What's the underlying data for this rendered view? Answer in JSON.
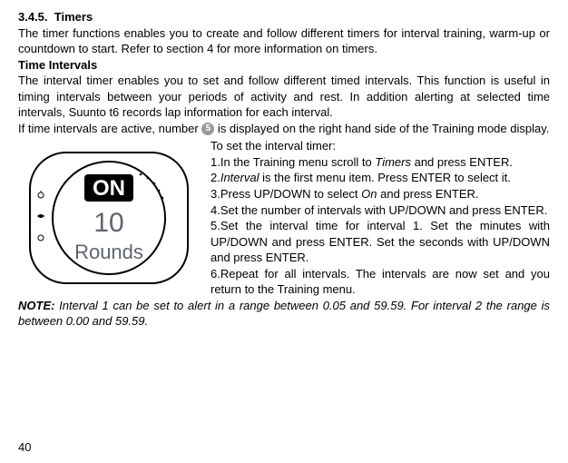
{
  "heading_number": "3.4.5.",
  "heading_title": "Timers",
  "intro": "The timer functions enables you to create and follow different timers for interval training, warm-up or countdown to start. Refer to section 4 for more information on timers.",
  "sub_heading": "Time Intervals",
  "sub_para1": "The interval timer enables you to set and follow different timed intervals. This function is useful in timing intervals between your periods of activity and rest. In addition alerting at selected time intervals, Suunto t6 records lap information for each interval.",
  "sub_para2_a": "If time intervals are active, number ",
  "circle_number": "5",
  "sub_para2_b": " is displayed on the right hand side of the Training mode display.",
  "watch": {
    "top": "ON",
    "mid": "10",
    "bottom": "Rounds"
  },
  "instr_lead": "To set the interval timer:",
  "instr1_a": "1.In the Training menu scroll to ",
  "instr1_i": "Timers",
  "instr1_b": " and press ENTER.",
  "instr2_a": "2.",
  "instr2_i": "Interval",
  "instr2_b": " is the first menu item. Press ENTER to select it.",
  "instr3_a": "3.Press UP/DOWN to select ",
  "instr3_i": "On",
  "instr3_b": " and press ENTER.",
  "instr4": "4.Set the number of intervals with UP/DOWN and press ENTER.",
  "instr5": "5.Set the interval time for interval 1. Set the minutes with UP/DOWN and press ENTER. Set the seconds with UP/DOWN and press ENTER.",
  "instr6": "6.Repeat for all intervals. The intervals are now set and you return to the Training menu.",
  "note_label": "NOTE:",
  "note_text": "  Interval 1 can be set to alert in a range between 0.05 and 59.59. For interval 2 the range is between 0.00 and 59.59.",
  "page_number": "40"
}
